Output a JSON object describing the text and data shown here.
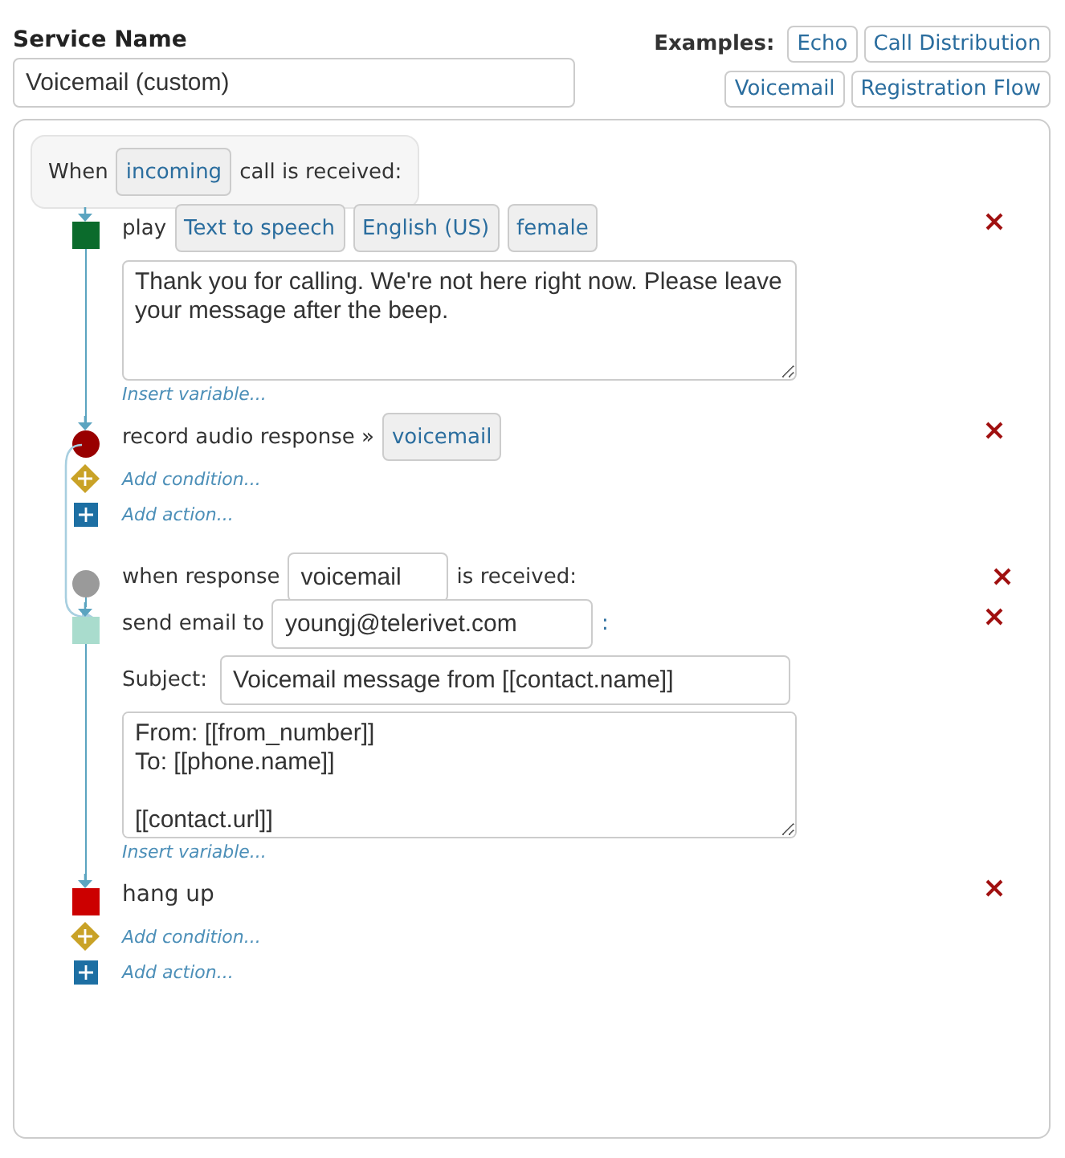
{
  "service_name": {
    "label": "Service Name",
    "value": "Voicemail (custom)"
  },
  "examples": {
    "label": "Examples:",
    "items": [
      "Echo",
      "Call Distribution",
      "Voicemail",
      "Registration Flow"
    ]
  },
  "trigger": {
    "prefix": "When",
    "option": "incoming",
    "suffix": "call is received:"
  },
  "steps": [
    {
      "kind": "play",
      "label": "play",
      "options": [
        "Text to speech",
        "English (US)",
        "female"
      ],
      "message": "Thank you for calling. We're not here right now. Please leave your message after the beep.",
      "insert_variable": "Insert variable..."
    },
    {
      "kind": "record",
      "label": "record audio response »",
      "option": "voicemail",
      "add_condition": "Add condition...",
      "add_action": "Add action..."
    },
    {
      "kind": "response",
      "label": "when response",
      "value": "voicemail",
      "suffix": "is received:"
    },
    {
      "kind": "email",
      "label": "send email to",
      "to": "youngj@telerivet.com",
      "colon": ":",
      "subject_label": "Subject:",
      "subject": "Voicemail message from [[contact.name]]",
      "body": "From: [[from_number]]\nTo: [[phone.name]]\n\n[[contact.url]]",
      "insert_variable": "Insert variable..."
    },
    {
      "kind": "hangup",
      "label": "hang up",
      "add_condition": "Add condition...",
      "add_action": "Add action..."
    }
  ]
}
